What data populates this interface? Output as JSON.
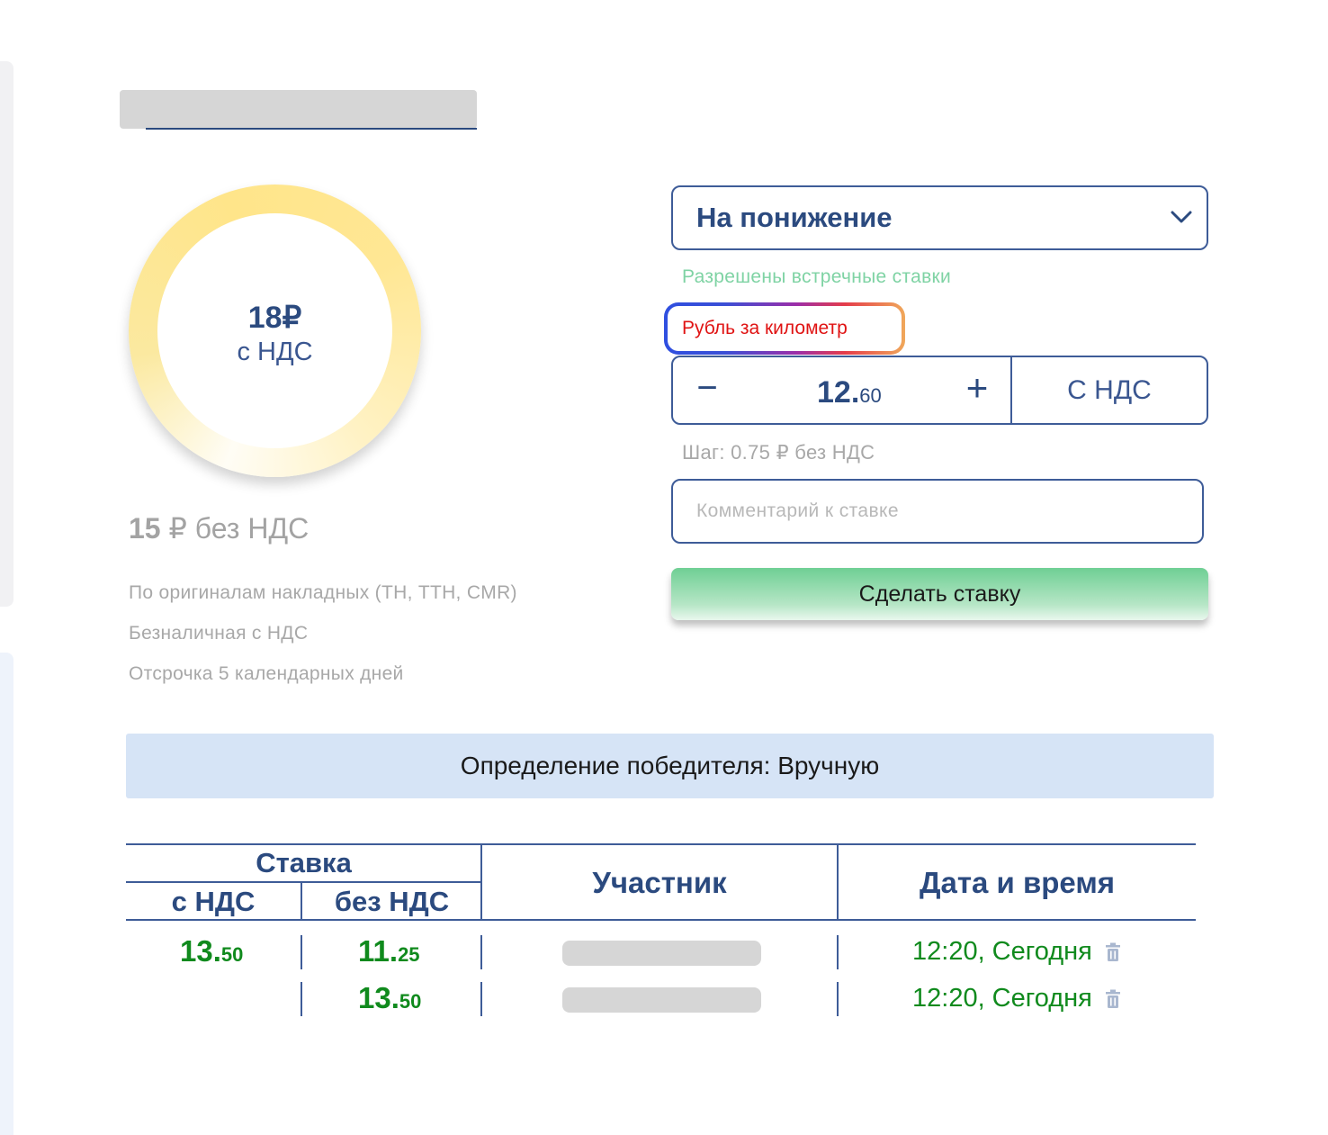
{
  "header": {
    "title": ""
  },
  "price_ring": {
    "value": "18₽",
    "vat_label": "с НДС",
    "fill_fraction": 1.0,
    "color": "#ffe58a"
  },
  "price_without_vat": {
    "amount": "15",
    "text": " ₽ без НДС"
  },
  "conditions": [
    "По оригиналам накладных (ТН, ТТН, CMR)",
    "Безналичная с НДС",
    "Отсрочка 5 календарных дней"
  ],
  "bid_form": {
    "mode_select": {
      "selected": "На понижение"
    },
    "counter_bids_note": "Разрешены встречные ставки",
    "unit_label": "Рубль за километр",
    "stepper": {
      "minus_label": "−",
      "value_int": "12.",
      "value_dec": "60",
      "plus_label": "+",
      "vat_toggle": "С НДС"
    },
    "step_note": "Шаг: 0.75 ₽ без НДС",
    "comment_placeholder": "Комментарий к ставке",
    "submit_label": "Сделать ставку"
  },
  "winner_bar": {
    "text": "Определение победителя: Вручную"
  },
  "bids_table": {
    "headers": {
      "group": "Ставка",
      "with_vat": "с НДС",
      "without_vat": "без НДС",
      "participant": "Участник",
      "datetime": "Дата и время"
    },
    "rows": [
      {
        "with_vat_int": "13.",
        "with_vat_dec": "50",
        "without_vat_int": "11.",
        "without_vat_dec": "25",
        "participant": "",
        "datetime": "12:20, Сегодня"
      },
      {
        "with_vat_int": "",
        "with_vat_dec": "",
        "without_vat_int": "13.",
        "without_vat_dec": "50",
        "participant": "",
        "datetime": "12:20, Сегодня"
      }
    ]
  },
  "colors": {
    "primary": "#2b4a7f",
    "accent_green": "#108a1d",
    "warning_red": "#e01313",
    "banner_bg": "#d6e4f6"
  },
  "icons": [
    "chevron-down-icon",
    "trash-icon"
  ]
}
